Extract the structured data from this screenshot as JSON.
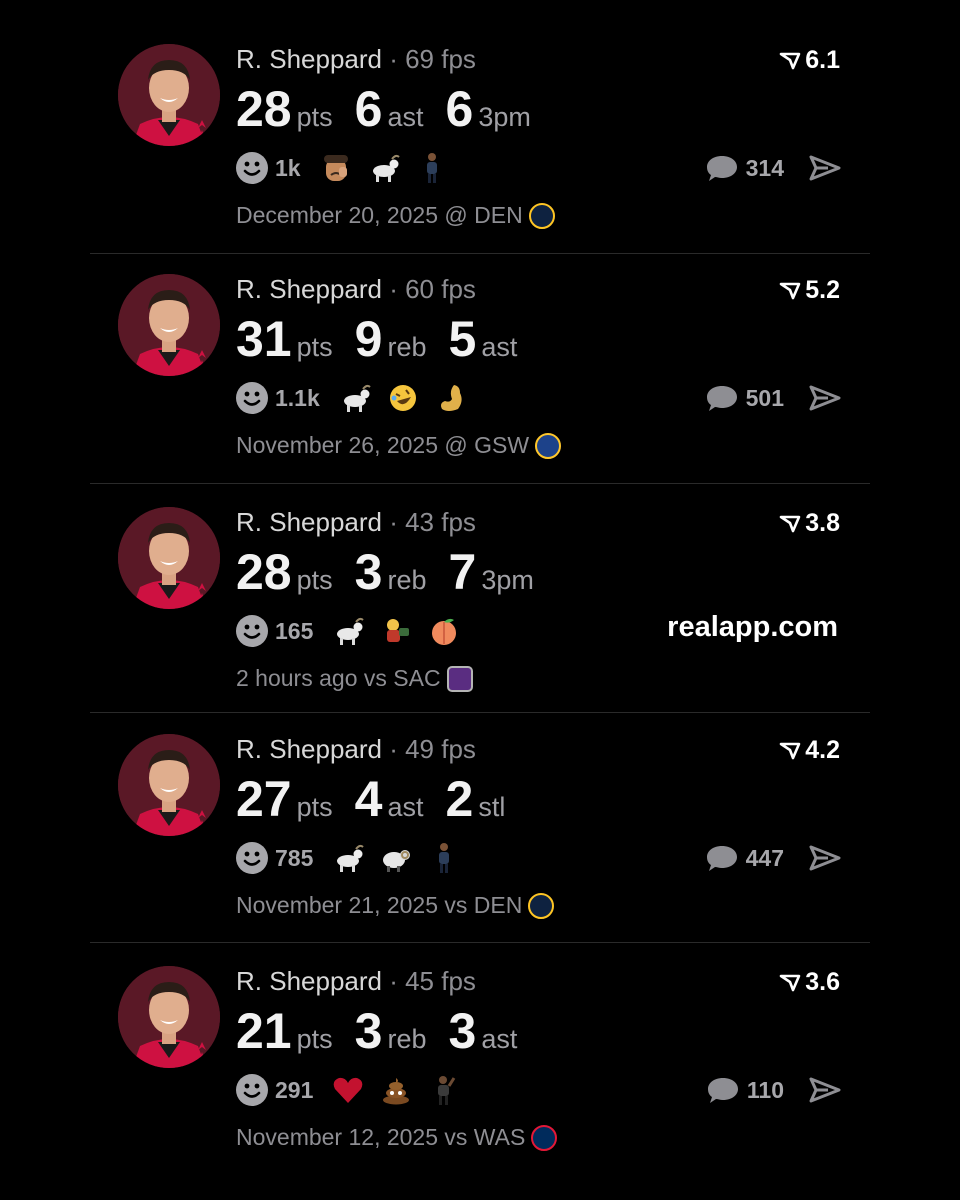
{
  "colors": {
    "background": "#000000",
    "text_primary": "#f2f2f2",
    "text_secondary": "#8e8e93",
    "avatar_bg": "#5a1826",
    "rockets_red": "#ce1141"
  },
  "brand": "realapp.com",
  "posts": [
    {
      "player": "R. Sheppard",
      "sep": " · ",
      "fps": "69 fps",
      "rating": "6.1",
      "stats": [
        {
          "num": "28",
          "unit": "pts"
        },
        {
          "num": "6",
          "unit": "ast"
        },
        {
          "num": "6",
          "unit": "3pm"
        }
      ],
      "reaction_count": "1k",
      "reactions": [
        "crying-face-emoji",
        "goat-emoji",
        "person-standing-emoji"
      ],
      "comments": "314",
      "date": "December 20, 2025 @ DEN",
      "team_logo": "nuggets-logo"
    },
    {
      "player": "R. Sheppard",
      "sep": " · ",
      "fps": "60 fps",
      "rating": "5.2",
      "stats": [
        {
          "num": "31",
          "unit": "pts"
        },
        {
          "num": "9",
          "unit": "reb"
        },
        {
          "num": "5",
          "unit": "ast"
        }
      ],
      "reaction_count": "1.1k",
      "reactions": [
        "goat-emoji",
        "rolling-laughing-emoji",
        "flexed-biceps-emoji"
      ],
      "comments": "501",
      "date": "November 26, 2025 @ GSW",
      "team_logo": "warriors-logo"
    },
    {
      "player": "R. Sheppard",
      "sep": " · ",
      "fps": "43 fps",
      "rating": "3.8",
      "stats": [
        {
          "num": "28",
          "unit": "pts"
        },
        {
          "num": "3",
          "unit": "reb"
        },
        {
          "num": "7",
          "unit": "3pm"
        }
      ],
      "reaction_count": "165",
      "reactions": [
        "goat-emoji",
        "cartoon-character-emoji",
        "peach-emoji"
      ],
      "comments": "",
      "date": "2 hours ago vs SAC",
      "team_logo": "kings-logo"
    },
    {
      "player": "R. Sheppard",
      "sep": " · ",
      "fps": "49 fps",
      "rating": "4.2",
      "stats": [
        {
          "num": "27",
          "unit": "pts"
        },
        {
          "num": "4",
          "unit": "ast"
        },
        {
          "num": "2",
          "unit": "stl"
        }
      ],
      "reaction_count": "785",
      "reactions": [
        "goat-emoji",
        "ram-emoji",
        "person-standing-emoji"
      ],
      "comments": "447",
      "date": "November 21, 2025 vs DEN",
      "team_logo": "nuggets-logo"
    },
    {
      "player": "R. Sheppard",
      "sep": " · ",
      "fps": "45 fps",
      "rating": "3.6",
      "stats": [
        {
          "num": "21",
          "unit": "pts"
        },
        {
          "num": "3",
          "unit": "reb"
        },
        {
          "num": "3",
          "unit": "ast"
        }
      ],
      "reaction_count": "291",
      "reactions": [
        "red-heart-emoji",
        "pile-of-poo-emoji",
        "player-celebrating-emoji"
      ],
      "comments": "110",
      "date": "November 12, 2025 vs WAS",
      "team_logo": "wizards-logo"
    }
  ]
}
